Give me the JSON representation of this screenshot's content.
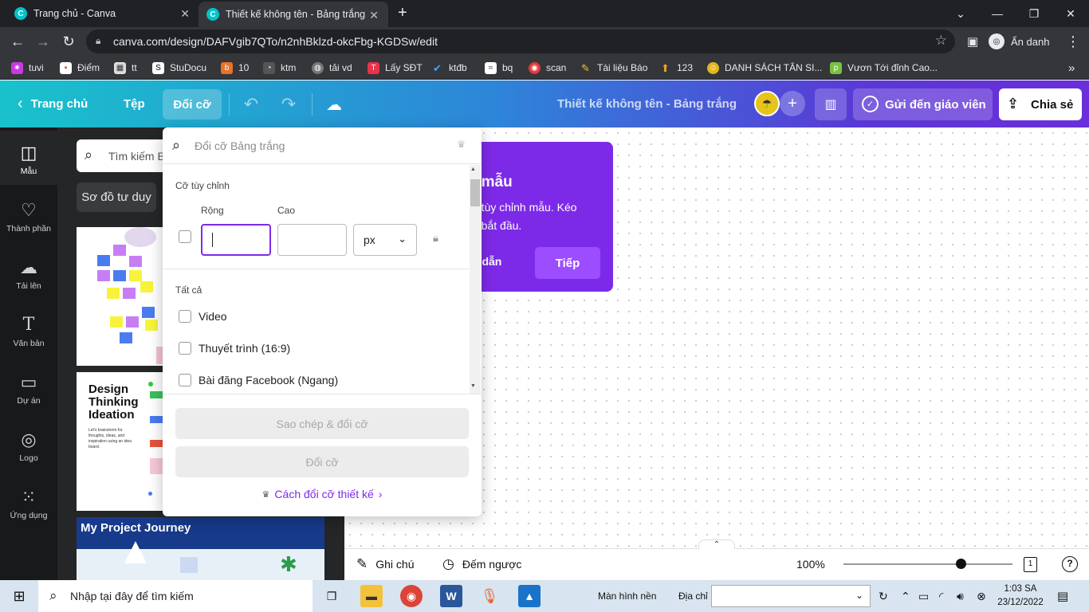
{
  "browser": {
    "tabs": [
      {
        "title": "Trang chủ - Canva"
      },
      {
        "title": "Thiết kế không tên - Bảng trắng"
      }
    ],
    "new_tab": "+",
    "url": "canva.com/design/DAFVgib7QTo/n2nhBklzd-okcFbg-KGDSw/edit",
    "profile_label": "Ẩn danh",
    "bookmarks": [
      "tuvi",
      "Điểm",
      "tt",
      "StuDocu",
      "10",
      "ktm",
      "tải vd",
      "Lấy SĐT",
      "ktđb",
      "bq",
      "scan",
      "Tài liệu Báo",
      "123",
      "DANH SÁCH TÂN SI...",
      "Vươn Tới đỉnh Cao..."
    ],
    "bookmarks_more": "»"
  },
  "canva_header": {
    "home": "Trang chủ",
    "file": "Tệp",
    "resize": "Đổi cỡ",
    "design_title": "Thiết kế không tên - Bảng trắng",
    "send_to_teacher": "Gửi đến giáo viên",
    "share": "Chia sẻ"
  },
  "sidebar": {
    "items": [
      {
        "label": "Mẫu",
        "icon": "template-icon"
      },
      {
        "label": "Thành phần",
        "icon": "elements-icon"
      },
      {
        "label": "Tải lên",
        "icon": "upload-icon"
      },
      {
        "label": "Văn bản",
        "icon": "text-icon"
      },
      {
        "label": "Dự án",
        "icon": "folder-icon"
      },
      {
        "label": "Logo",
        "icon": "logo-icon"
      },
      {
        "label": "Ứng dụng",
        "icon": "apps-icon"
      }
    ]
  },
  "panel": {
    "search_placeholder": "Tìm kiếm B",
    "chip": "Sơ đồ tư duy",
    "template2_title": "Design Thinking Ideation",
    "template2_sub": "Let's brainstorm for thoughts, ideas, and inspiration using an idea board.",
    "template3_title": "My Project Journey"
  },
  "resize_popup": {
    "search_placeholder": "Đổi cỡ Bảng trắng",
    "custom_size": "Cỡ tùy chỉnh",
    "width_label": "Rộng",
    "height_label": "Cao",
    "unit": "px",
    "width_value": "",
    "height_value": "",
    "all_label": "Tất cả",
    "options": [
      "Video",
      "Thuyết trình (16:9)",
      "Bài đăng Facebook (Ngang)"
    ],
    "copy_resize": "Sao chép & đổi cỡ",
    "resize_btn": "Đổi cỡ",
    "how_link": "Cách đổi cỡ thiết kế"
  },
  "tip": {
    "title": "t mẫu",
    "text": "ế tùy chỉnh mẫu. Kéo\nể bắt đầu.",
    "guide": "g dẫn",
    "next": "Tiếp"
  },
  "bottom_bar": {
    "notes": "Ghi chú",
    "timer": "Đếm ngược",
    "zoom": "100%",
    "zoom_level_fraction": 0.67,
    "page_count": "1",
    "help": "?"
  },
  "taskbar": {
    "search_placeholder": "Nhập tại đây để tìm kiếm",
    "desktop": "Màn hình nền",
    "address_label": "Địa chỉ",
    "time": "1:03 SA",
    "date": "23/12/2022"
  },
  "colors": {
    "canva_purple": "#7d2ae8",
    "sidebar_bg": "#18191b",
    "panel_bg": "#252627"
  }
}
